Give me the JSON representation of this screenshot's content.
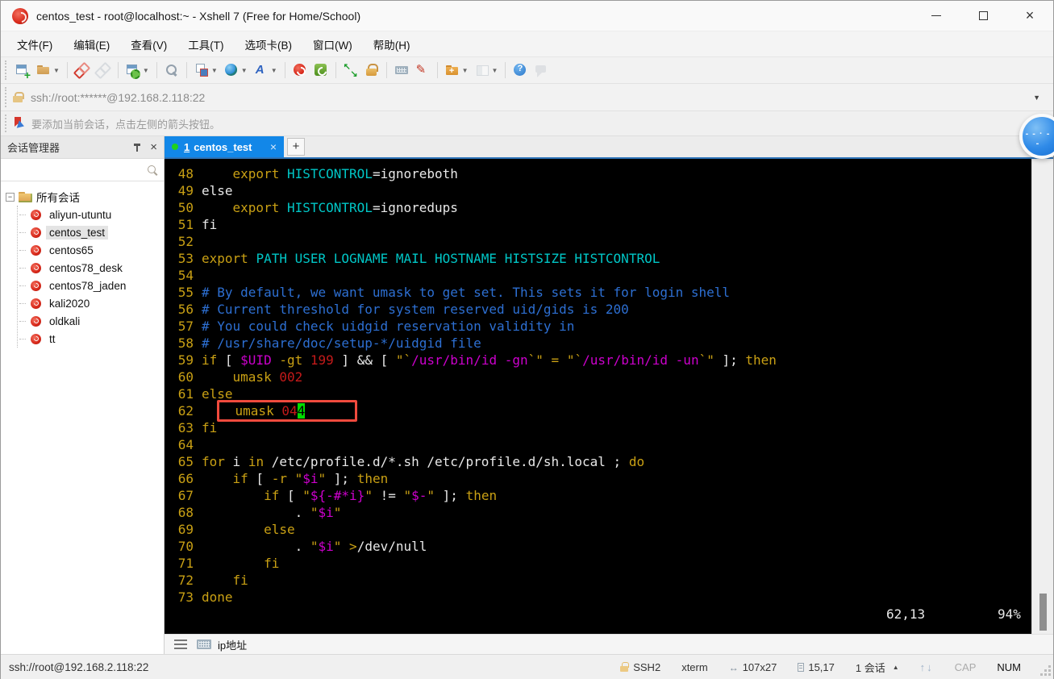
{
  "window": {
    "title": "centos_test - root@localhost:~ - Xshell 7 (Free for Home/School)",
    "minimize": "—",
    "maximize": "",
    "close": "×"
  },
  "menu": {
    "items": [
      "文件(F)",
      "编辑(E)",
      "查看(V)",
      "工具(T)",
      "选项卡(B)",
      "窗口(W)",
      "帮助(H)"
    ]
  },
  "toolbar": {
    "icons": [
      {
        "name": "new-terminal"
      },
      {
        "name": "open-folder",
        "dropdown": true
      },
      {
        "sep": true
      },
      {
        "name": "disconnect"
      },
      {
        "name": "reconnect",
        "disabled": true
      },
      {
        "sep": true
      },
      {
        "name": "session-properties",
        "dropdown": true
      },
      {
        "sep": true
      },
      {
        "name": "find"
      },
      {
        "sep": true
      },
      {
        "name": "layout",
        "dropdown": true
      },
      {
        "name": "web",
        "dropdown": true
      },
      {
        "name": "font",
        "dropdown": true
      },
      {
        "sep": true
      },
      {
        "name": "xshell"
      },
      {
        "name": "xftp"
      },
      {
        "sep": true
      },
      {
        "name": "fullscreen"
      },
      {
        "name": "lock-screen"
      },
      {
        "sep": true
      },
      {
        "name": "virtual-keyboard"
      },
      {
        "name": "highlight-pen"
      },
      {
        "sep": true
      },
      {
        "name": "new-folder",
        "dropdown": true
      },
      {
        "name": "tile-windows",
        "dropdown": true,
        "disabled": true
      },
      {
        "sep": true
      },
      {
        "name": "help"
      },
      {
        "name": "feedback",
        "disabled": true
      }
    ]
  },
  "address_bar": {
    "url": "ssh://root:******@192.168.2.118:22",
    "dropdown": "▼"
  },
  "info_bar": {
    "text": "要添加当前会话，点击左侧的箭头按钮。"
  },
  "sidebar": {
    "title": "会话管理器",
    "close": "×",
    "root_label": "所有会话",
    "expander": "−",
    "sessions": [
      "aliyun-utuntu",
      "centos_test",
      "centos65",
      "centos78_desk",
      "centos78_jaden",
      "kali2020",
      "oldkali",
      "tt"
    ],
    "selected": "centos_test"
  },
  "tabs": {
    "active_index": "1",
    "active_label": "centos_test",
    "close": "×",
    "new_tab": "+"
  },
  "terminal": {
    "colors": {
      "w": "#e8e8e8",
      "y": "#c9a014",
      "c": "#00c6c6",
      "b": "#2d6fd2",
      "m": "#cd00cd",
      "r": "#c41a1a",
      "curbg": "#00dc00"
    },
    "ruler": {
      "position": "62,13",
      "percent": "94%"
    },
    "lines": [
      {
        "n": "48",
        "body": [
          [
            "    ",
            "w"
          ],
          [
            "export",
            "y"
          ],
          [
            " ",
            "w"
          ],
          [
            "HISTCONTROL",
            "c"
          ],
          [
            "=ignoreboth",
            "w"
          ]
        ]
      },
      {
        "n": "49",
        "body": [
          [
            "else",
            "w"
          ]
        ]
      },
      {
        "n": "50",
        "body": [
          [
            "    ",
            "w"
          ],
          [
            "export",
            "y"
          ],
          [
            " ",
            "w"
          ],
          [
            "HISTCONTROL",
            "c"
          ],
          [
            "=ignoredups",
            "w"
          ]
        ]
      },
      {
        "n": "51",
        "body": [
          [
            "fi",
            "w"
          ]
        ]
      },
      {
        "n": "52",
        "body": []
      },
      {
        "n": "53",
        "body": [
          [
            "export",
            "y"
          ],
          [
            " ",
            "w"
          ],
          [
            "PATH USER LOGNAME MAIL HOSTNAME HISTSIZE HISTCONTROL",
            "c"
          ]
        ]
      },
      {
        "n": "54",
        "body": []
      },
      {
        "n": "55",
        "body": [
          [
            "# By default, we want umask to get set. This sets it for login shell",
            "b"
          ]
        ]
      },
      {
        "n": "56",
        "body": [
          [
            "# Current threshold for system reserved uid/gids is 200",
            "b"
          ]
        ]
      },
      {
        "n": "57",
        "body": [
          [
            "# You could check uidgid reservation validity in",
            "b"
          ]
        ]
      },
      {
        "n": "58",
        "body": [
          [
            "# /usr/share/doc/setup-*/uidgid file",
            "b"
          ]
        ]
      },
      {
        "n": "59",
        "body": [
          [
            "if",
            "y"
          ],
          [
            " [ ",
            "w"
          ],
          [
            "$UID",
            "m"
          ],
          [
            " ",
            "w"
          ],
          [
            "-gt",
            "y"
          ],
          [
            " ",
            "w"
          ],
          [
            "199",
            "r"
          ],
          [
            " ] && [ ",
            "w"
          ],
          [
            "\"`",
            "y"
          ],
          [
            "/usr/bin/id -gn",
            "m"
          ],
          [
            "`\"",
            "y"
          ],
          [
            " ",
            "w"
          ],
          [
            "=",
            "y"
          ],
          [
            " ",
            "w"
          ],
          [
            "\"`",
            "y"
          ],
          [
            "/usr/bin/id -un",
            "m"
          ],
          [
            "`\"",
            "y"
          ],
          [
            " ]; ",
            "w"
          ],
          [
            "then",
            "y"
          ]
        ]
      },
      {
        "n": "60",
        "body": [
          [
            "    ",
            "w"
          ],
          [
            "umask",
            "y"
          ],
          [
            " ",
            "w"
          ],
          [
            "002",
            "r"
          ]
        ]
      },
      {
        "n": "61",
        "body": [
          [
            "else",
            "y"
          ]
        ]
      },
      {
        "n": "62",
        "boxed": true,
        "pre": [
          [
            "  ",
            "w"
          ]
        ],
        "body": [
          [
            "  ",
            "w"
          ],
          [
            "umask",
            "y"
          ],
          [
            " ",
            "w"
          ],
          [
            "04",
            "r"
          ],
          [
            "4",
            "cur"
          ]
        ]
      },
      {
        "n": "63",
        "body": [
          [
            "fi",
            "y"
          ]
        ]
      },
      {
        "n": "64",
        "body": []
      },
      {
        "n": "65",
        "body": [
          [
            "for",
            "y"
          ],
          [
            " i ",
            "w"
          ],
          [
            "in",
            "y"
          ],
          [
            " /etc/profile.d/*.sh /etc/profile.d/sh.local ; ",
            "w"
          ],
          [
            "do",
            "y"
          ]
        ]
      },
      {
        "n": "66",
        "body": [
          [
            "    ",
            "w"
          ],
          [
            "if",
            "y"
          ],
          [
            " [ ",
            "w"
          ],
          [
            "-r",
            "y"
          ],
          [
            " ",
            "w"
          ],
          [
            "\"",
            "y"
          ],
          [
            "$i",
            "m"
          ],
          [
            "\"",
            "y"
          ],
          [
            " ]; ",
            "w"
          ],
          [
            "then",
            "y"
          ]
        ]
      },
      {
        "n": "67",
        "body": [
          [
            "        ",
            "w"
          ],
          [
            "if",
            "y"
          ],
          [
            " [ ",
            "w"
          ],
          [
            "\"",
            "y"
          ],
          [
            "${-#*i}",
            "m"
          ],
          [
            "\"",
            "y"
          ],
          [
            " != ",
            "w"
          ],
          [
            "\"",
            "y"
          ],
          [
            "$-",
            "m"
          ],
          [
            "\"",
            "y"
          ],
          [
            " ]; ",
            "w"
          ],
          [
            "then",
            "y"
          ]
        ]
      },
      {
        "n": "68",
        "body": [
          [
            "            . ",
            "w"
          ],
          [
            "\"",
            "y"
          ],
          [
            "$i",
            "m"
          ],
          [
            "\"",
            "y"
          ]
        ]
      },
      {
        "n": "69",
        "body": [
          [
            "        ",
            "w"
          ],
          [
            "else",
            "y"
          ]
        ]
      },
      {
        "n": "70",
        "body": [
          [
            "            . ",
            "w"
          ],
          [
            "\"",
            "y"
          ],
          [
            "$i",
            "m"
          ],
          [
            "\"",
            "y"
          ],
          [
            " ",
            "w"
          ],
          [
            ">",
            "y"
          ],
          [
            "/dev/null",
            "w"
          ]
        ]
      },
      {
        "n": "71",
        "body": [
          [
            "        ",
            "w"
          ],
          [
            "fi",
            "y"
          ]
        ]
      },
      {
        "n": "72",
        "body": [
          [
            "    ",
            "w"
          ],
          [
            "fi",
            "y"
          ]
        ]
      },
      {
        "n": "73",
        "body": [
          [
            "done",
            "y"
          ]
        ]
      }
    ]
  },
  "quickbar": {
    "label": "ip地址"
  },
  "statusbar": {
    "left": "ssh://root@192.168.2.118:22",
    "protocol": "SSH2",
    "term_type": "xterm",
    "size": "107x27",
    "cursor": "15,17",
    "session_count": "1 会话",
    "session_dd": "▲",
    "updown": "↑↓",
    "cap": "CAP",
    "num": "NUM"
  }
}
